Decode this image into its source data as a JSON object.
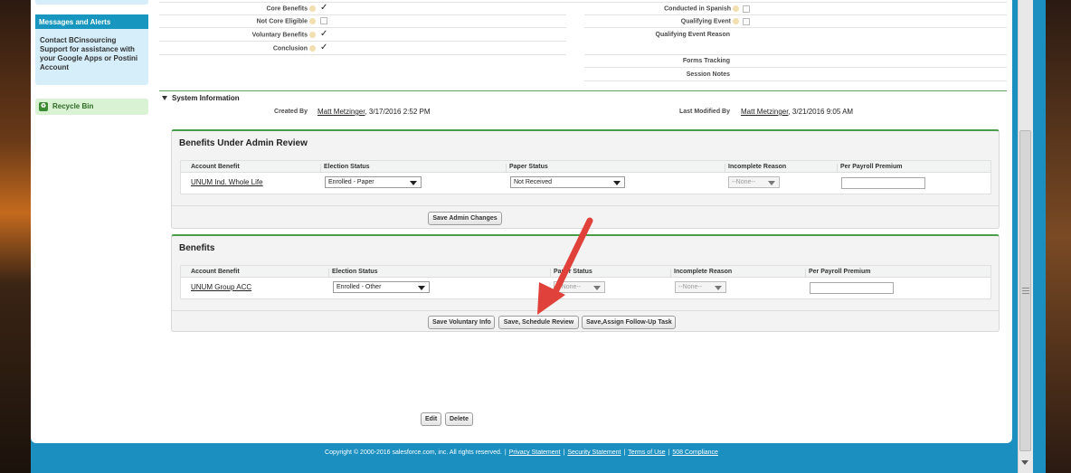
{
  "sidebar": {
    "messages_title": "Messages and Alerts",
    "messages_body": "Contact BCinsourcing Support for assistance with your Google Apps or Postini Account",
    "recycle_bin": "Recycle Bin"
  },
  "details": {
    "left": [
      {
        "label": "Core Benefits",
        "checked": true
      },
      {
        "label": "Not Core Eligible",
        "checked": false
      },
      {
        "label": "Voluntary Benefits",
        "checked": true
      },
      {
        "label": "Conclusion",
        "checked": true
      }
    ],
    "right": [
      {
        "label": "Conducted in Spanish"
      },
      {
        "label": "Qualifying Event"
      },
      {
        "label": "Qualifying Event Reason"
      },
      {
        "label": "Forms Tracking"
      },
      {
        "label": "Session Notes"
      }
    ],
    "check_glyph": "✓"
  },
  "system": {
    "title": "System Information",
    "created_by_label": "Created By",
    "created_by_user": "Matt Metzinger",
    "created_by_date": ", 3/17/2016 2:52 PM",
    "modified_label": "Last Modified By",
    "modified_user": "Matt Metzinger",
    "modified_date": ", 3/21/2016 9:05 AM"
  },
  "admin_review": {
    "title": "Benefits Under Admin Review",
    "columns": [
      "Account Benefit",
      "Election Status",
      "Paper Status",
      "Incomplete Reason",
      "Per Payroll Premium"
    ],
    "row": {
      "benefit": "UNUM Ind. Whole Life",
      "election": "Enrolled - Paper",
      "paper": "Not Received",
      "incomplete": "--None--"
    },
    "save_button": "Save Admin Changes"
  },
  "benefits": {
    "title": "Benefits",
    "columns": [
      "Account Benefit",
      "Election Status",
      "Paper Status",
      "Incomplete Reason",
      "Per Payroll Premium"
    ],
    "row": {
      "benefit": "UNUM Group ACC",
      "election": "Enrolled - Other",
      "paper": "--None--",
      "incomplete": "--None--"
    },
    "buttons": [
      "Save Voluntary Info",
      "Save, Schedule Review",
      "Save,Assign Follow-Up Task"
    ]
  },
  "actions": {
    "edit": "Edit",
    "delete": "Delete"
  },
  "footer": {
    "copyright": "Copyright © 2000-2016 salesforce.com, inc. All rights reserved.",
    "links": [
      "Privacy Statement",
      "Security Statement",
      "Terms of Use",
      "508 Compliance"
    ]
  },
  "colors": {
    "accent": "#1797c0",
    "annotation_arrow": "#e0413a"
  }
}
